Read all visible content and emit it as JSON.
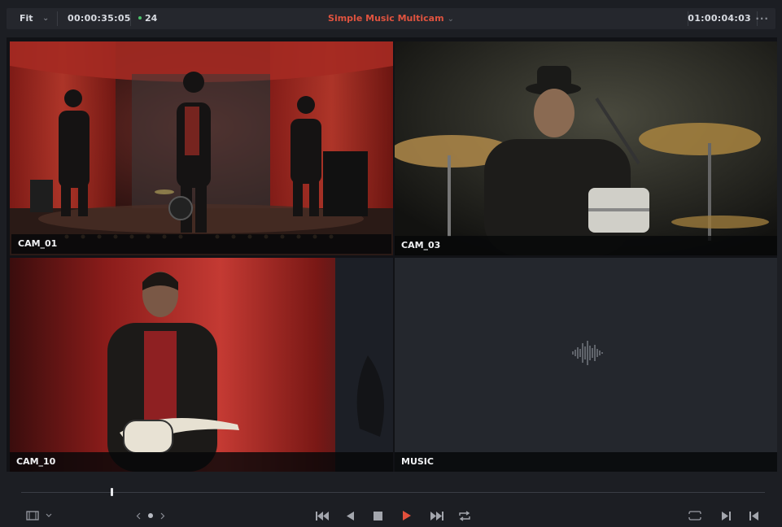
{
  "topbar": {
    "zoom": "Fit",
    "source_timecode": "00:00:35:05",
    "fps": "24",
    "title": "Simple Music Multicam",
    "record_timecode": "01:00:04:03",
    "more": "···"
  },
  "viewer": {
    "angles": [
      {
        "label": "CAM_01",
        "active": true
      },
      {
        "label": "CAM_03",
        "active": false
      },
      {
        "label": "CAM_10",
        "active": false
      },
      {
        "label": "MUSIC",
        "active": false
      }
    ]
  },
  "playback": {
    "position_fraction": 0.12
  },
  "colors": {
    "accent": "#e2503c",
    "play": "#e2503c",
    "fps_dot": "#4cc36b",
    "background": "#1c1e23"
  },
  "icons": [
    "display-mode-icon",
    "chevron-down-icon",
    "prev-angle-icon",
    "angle-dot-icon",
    "next-angle-icon",
    "go-to-start-icon",
    "step-back-icon",
    "stop-icon",
    "play-icon",
    "go-to-end-icon",
    "loop-icon",
    "match-frame-icon",
    "mark-in-icon",
    "mark-out-icon",
    "waveform-icon"
  ]
}
